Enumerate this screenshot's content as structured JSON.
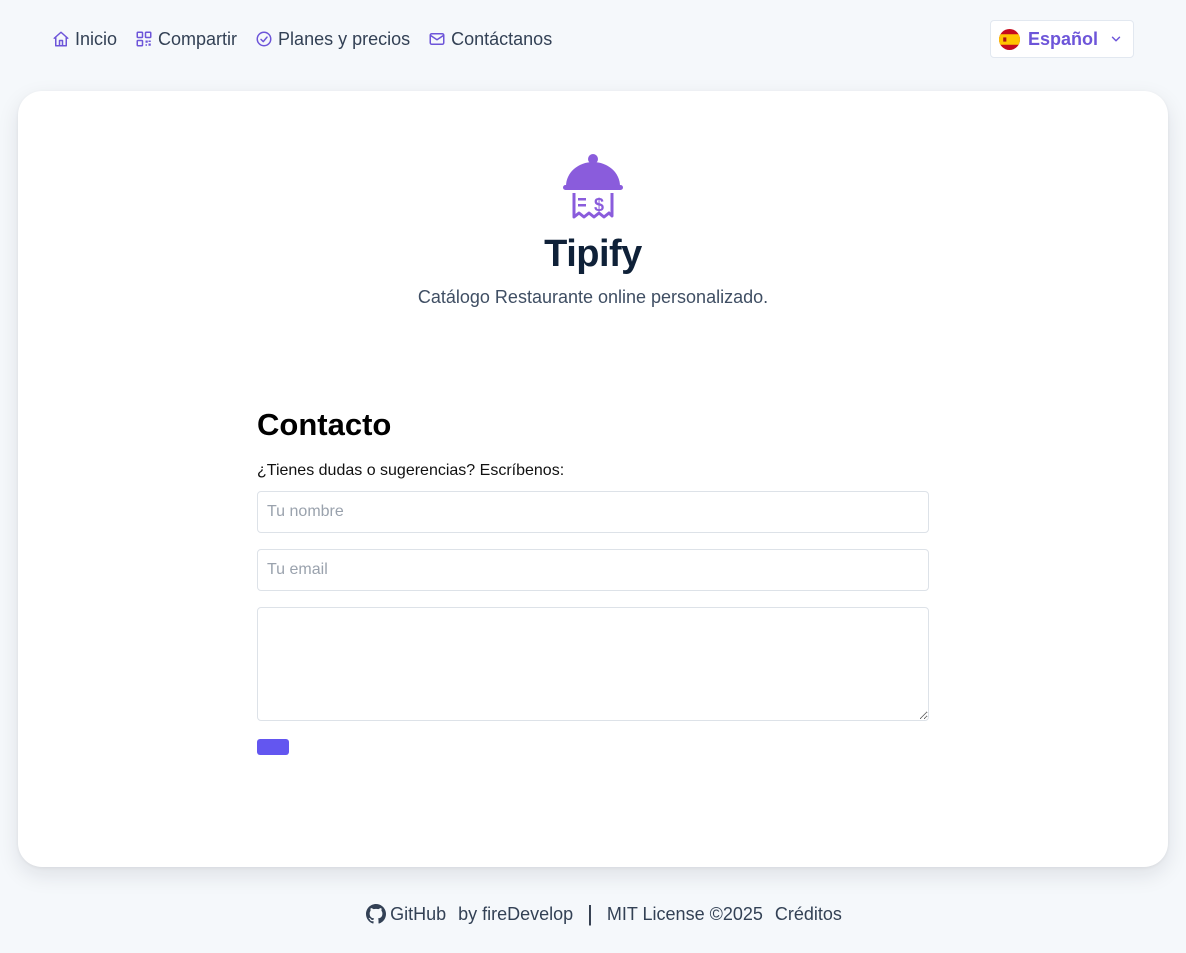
{
  "nav": {
    "items": [
      {
        "label": "Inicio",
        "icon": "home-icon"
      },
      {
        "label": "Compartir",
        "icon": "qr-code-icon"
      },
      {
        "label": "Planes y precios",
        "icon": "check-circle-icon"
      },
      {
        "label": "Contáctanos",
        "icon": "mail-icon"
      }
    ],
    "language": {
      "label": "Español",
      "flag": "spain-flag-icon"
    }
  },
  "brand": {
    "name": "Tipify",
    "tagline": "Catálogo Restaurante online personalizado.",
    "icon": "cloche-receipt-icon"
  },
  "contact": {
    "title": "Contacto",
    "prompt": "¿Tienes dudas o sugerencias? Escríbenos:",
    "name_placeholder": "Tu nombre",
    "email_placeholder": "Tu email",
    "message_placeholder": ""
  },
  "footer": {
    "github_label": "GitHub",
    "by_label": "by fireDevelop",
    "separator": "|",
    "license_label": "MIT License ©2025",
    "credits_label": "Créditos"
  },
  "colors": {
    "accent": "#6356f0",
    "brand_purple": "#8a5cdc",
    "language_text": "#6d55d9",
    "background": "#f5f8fb"
  }
}
